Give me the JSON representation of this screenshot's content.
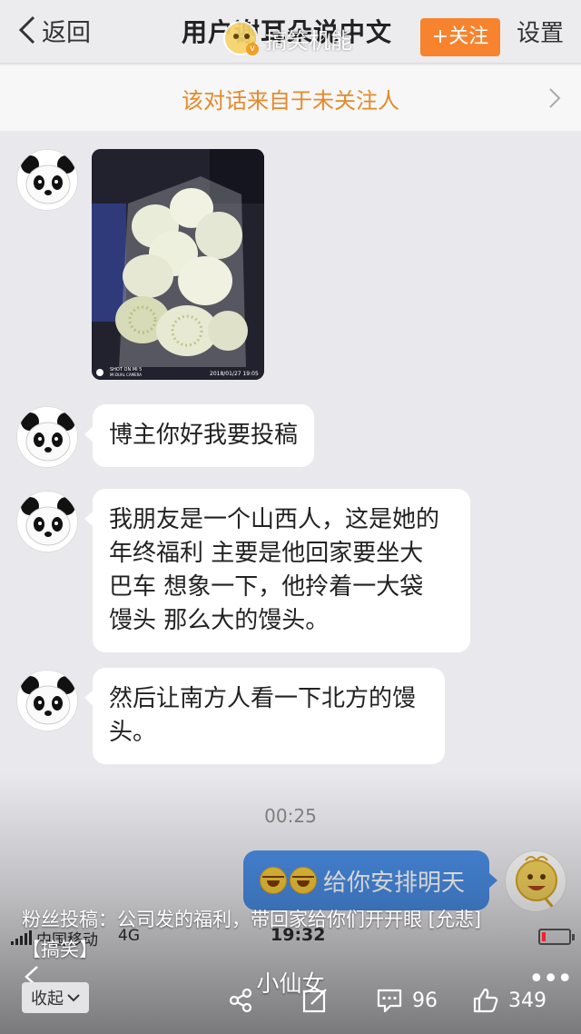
{
  "nav": {
    "back_label": "返回",
    "title": "用户谢耳朵说中文",
    "follow_label": "+关注",
    "settings_label": "设置"
  },
  "watermark": {
    "account_name": "搞笑机能"
  },
  "notice": {
    "text": "该对话来自于未关注人"
  },
  "messages": [
    {
      "type": "image",
      "sender": "other",
      "image_text": [
        "SHOT ON MI 5",
        "MI DUAL CAMERA",
        "2018/01/27  19:05"
      ]
    },
    {
      "type": "text",
      "sender": "other",
      "text": "博主你好我要投稿"
    },
    {
      "type": "text",
      "sender": "other",
      "lines": [
        "我朋友是一个山西人，这是她的",
        "年终福利 主要是他回家要坐大",
        "巴车 想象一下，他拎着一大袋",
        "馒头 那么大的馒头。"
      ]
    },
    {
      "type": "text",
      "sender": "other",
      "lines": [
        "然后让南方人看一下北方的馒",
        "头。"
      ]
    }
  ],
  "timestamp": "00:25",
  "my_message": {
    "emoji": [
      "laugh-cry",
      "laugh-cry"
    ],
    "text": "给你安排明天"
  },
  "status_bar": {
    "carrier": "中国移动",
    "network": "4G",
    "time": "19:32"
  },
  "caption": {
    "line1": "粉丝投稿：公司发的福利，带回家给你们开开眼 [允悲]",
    "line2": "【搞笑】"
  },
  "post": {
    "nickname": "小仙女",
    "more_label": "•••",
    "collapse_label": "收起",
    "comment_count": "96",
    "like_count": "349"
  },
  "colors": {
    "accent_orange": "#f7832f",
    "notice_orange": "#e58a29",
    "my_bubble_blue": "#4a8ee6",
    "chat_background": "#e9e9ed"
  }
}
